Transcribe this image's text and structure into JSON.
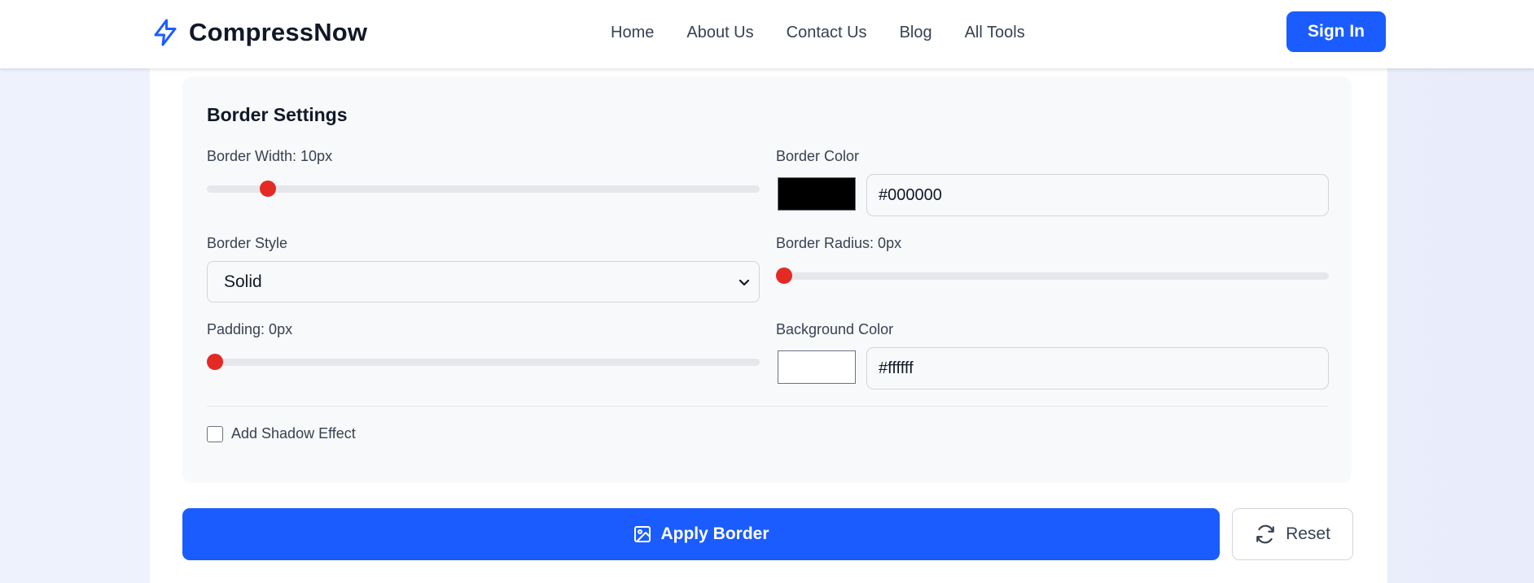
{
  "brand": {
    "name": "CompressNow",
    "icon": "lightning-bolt-icon",
    "accent": "#1a5cff"
  },
  "nav": {
    "items": [
      {
        "label": "Home"
      },
      {
        "label": "About Us"
      },
      {
        "label": "Contact Us"
      },
      {
        "label": "Blog"
      },
      {
        "label": "All Tools"
      }
    ],
    "signin_label": "Sign In"
  },
  "settings": {
    "title": "Border Settings",
    "border_width": {
      "label": "Border Width: 10px",
      "fraction": 0.11
    },
    "border_color": {
      "label": "Border Color",
      "swatch": "#000000",
      "value": "#000000"
    },
    "border_style": {
      "label": "Border Style",
      "selected": "Solid"
    },
    "border_radius": {
      "label": "Border Radius: 0px",
      "fraction": 0.0
    },
    "padding": {
      "label": "Padding: 0px",
      "fraction": 0.0
    },
    "background_color": {
      "label": "Background Color",
      "swatch": "#ffffff",
      "value": "#ffffff"
    },
    "shadow": {
      "label": "Add Shadow Effect",
      "checked": false
    },
    "thumb_color": "#e32a24"
  },
  "actions": {
    "apply_label": "Apply Border",
    "apply_icon": "image-icon",
    "reset_label": "Reset",
    "reset_icon": "refresh-icon"
  }
}
